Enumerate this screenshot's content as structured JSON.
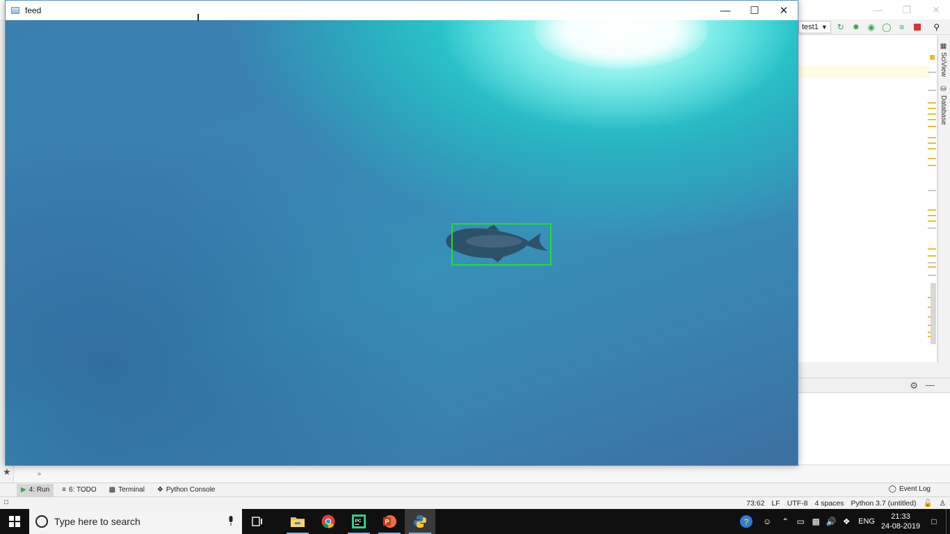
{
  "ide": {
    "run_config": "test1",
    "right_tabs": [
      "SciView",
      "Database"
    ],
    "toolwindows": [
      {
        "label": "4: Run",
        "active": true
      },
      {
        "label": "6: TODO",
        "active": false
      },
      {
        "label": "Terminal",
        "active": false
      },
      {
        "label": "Python Console",
        "active": false
      }
    ],
    "event_log": "Event Log",
    "status": {
      "position": "73:62",
      "line_sep": "LF",
      "encoding": "UTF-8",
      "indent": "4 spaces",
      "interpreter": "Python 3.7 (untitled)"
    }
  },
  "feed_window": {
    "title": "feed",
    "detection_box_color": "#22dd33"
  },
  "taskbar": {
    "search_placeholder": "Type here to search",
    "apps": [
      "task-view",
      "file-explorer",
      "chrome",
      "pycharm",
      "powerpoint",
      "python"
    ],
    "language": "ENG",
    "time": "21:33",
    "date": "24-08-2019"
  },
  "colors": {
    "accent_blue": "#5b8fc9",
    "taskbar_bg": "#101010",
    "marker_yellow": "#e6c32d"
  }
}
